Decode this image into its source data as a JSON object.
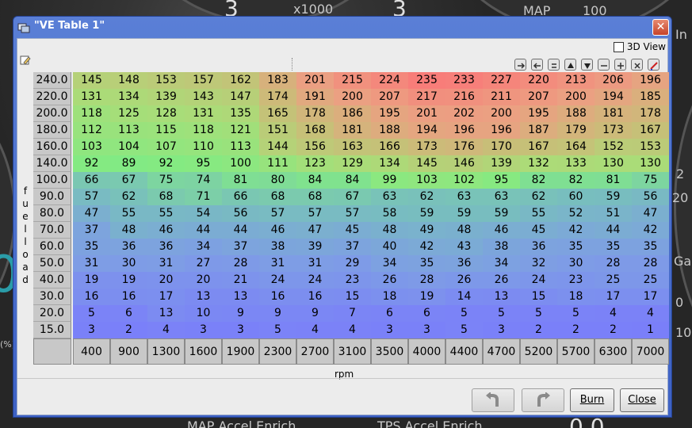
{
  "background": {
    "texts": [
      "3",
      "x1000",
      "3",
      "MAP",
      "100",
      "In",
      "2",
      "20",
      "Ga",
      "(%)",
      "0",
      "MAP Accel Enrich",
      "TPS Accel Enrich",
      "0.0",
      "10",
      "0"
    ]
  },
  "window": {
    "title": "\"VE Table 1\"",
    "close_glyph": "✕"
  },
  "view3d": {
    "label": "3D View",
    "checked": false
  },
  "toolbar_icons": [
    "arrow-right-icon",
    "arrow-left-icon",
    "equals-icon",
    "triangle-up-icon",
    "triangle-down-icon",
    "minus-icon",
    "plus-icon",
    "multiply-icon",
    "color-pen-icon"
  ],
  "table": {
    "y_axis_label": "fuel load",
    "x_axis_label": "rpm",
    "y_values": [
      "240.0",
      "220.0",
      "200.0",
      "180.0",
      "160.0",
      "140.0",
      "100.0",
      "90.0",
      "80.0",
      "70.0",
      "60.0",
      "50.0",
      "40.0",
      "30.0",
      "20.0",
      "15.0"
    ],
    "x_values": [
      "400",
      "900",
      "1300",
      "1600",
      "1900",
      "2300",
      "2700",
      "3100",
      "3500",
      "4000",
      "4400",
      "4700",
      "5200",
      "5700",
      "6300",
      "7000"
    ],
    "rows": [
      [
        145,
        148,
        153,
        157,
        162,
        183,
        201,
        215,
        224,
        235,
        233,
        227,
        220,
        213,
        206,
        196
      ],
      [
        131,
        134,
        139,
        143,
        147,
        174,
        191,
        200,
        207,
        217,
        216,
        211,
        207,
        200,
        194,
        185
      ],
      [
        118,
        125,
        128,
        131,
        135,
        165,
        178,
        186,
        195,
        201,
        202,
        200,
        195,
        188,
        181,
        178
      ],
      [
        112,
        113,
        115,
        118,
        121,
        151,
        168,
        181,
        188,
        194,
        196,
        196,
        187,
        179,
        173,
        167
      ],
      [
        103,
        104,
        107,
        110,
        113,
        144,
        156,
        163,
        166,
        173,
        176,
        170,
        167,
        164,
        152,
        153
      ],
      [
        92,
        89,
        92,
        95,
        100,
        111,
        123,
        129,
        134,
        145,
        146,
        139,
        132,
        133,
        130,
        130
      ],
      [
        66,
        67,
        75,
        74,
        81,
        80,
        84,
        84,
        99,
        103,
        102,
        95,
        82,
        82,
        81,
        75
      ],
      [
        57,
        62,
        68,
        71,
        66,
        68,
        68,
        67,
        63,
        62,
        63,
        63,
        62,
        60,
        59,
        56
      ],
      [
        47,
        55,
        55,
        54,
        56,
        57,
        57,
        57,
        58,
        59,
        59,
        59,
        55,
        52,
        51,
        47
      ],
      [
        37,
        48,
        46,
        44,
        44,
        46,
        47,
        45,
        48,
        49,
        48,
        46,
        45,
        42,
        44,
        42
      ],
      [
        35,
        36,
        36,
        34,
        37,
        38,
        39,
        37,
        40,
        42,
        43,
        38,
        36,
        35,
        35,
        35
      ],
      [
        31,
        30,
        31,
        27,
        28,
        31,
        31,
        29,
        34,
        35,
        36,
        34,
        32,
        30,
        28,
        28
      ],
      [
        19,
        19,
        20,
        20,
        21,
        24,
        24,
        23,
        26,
        28,
        26,
        26,
        24,
        23,
        25,
        25
      ],
      [
        16,
        16,
        17,
        13,
        13,
        16,
        16,
        15,
        18,
        19,
        14,
        13,
        15,
        18,
        17,
        17
      ],
      [
        5,
        6,
        13,
        10,
        9,
        9,
        9,
        7,
        6,
        6,
        5,
        5,
        5,
        5,
        4,
        4
      ],
      [
        3,
        2,
        4,
        3,
        3,
        5,
        4,
        4,
        3,
        3,
        5,
        3,
        2,
        2,
        2,
        1
      ]
    ]
  },
  "buttons": {
    "undo_icon": "undo-icon",
    "redo_icon": "redo-icon",
    "burn_label": "Burn",
    "close_label": "Close"
  }
}
